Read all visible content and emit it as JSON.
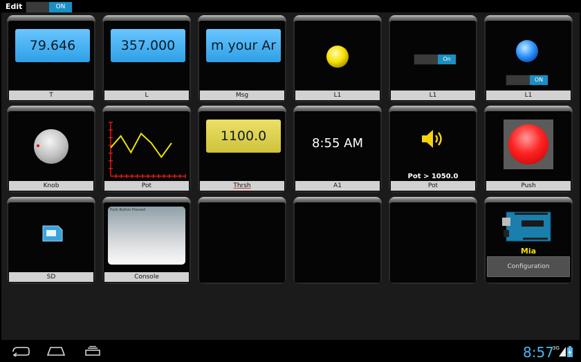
{
  "topbar": {
    "edit_label": "Edit",
    "edit_toggle_state": "ON"
  },
  "tiles": {
    "t_value": "79.646",
    "t_label": "T",
    "l_value": "357.000",
    "l_label": "L",
    "msg_value": "m your Ar",
    "msg_label": "Msg",
    "l1a_label": "L1",
    "l1b_label": "L1",
    "l1b_toggle": "On",
    "l1c_label": "L1",
    "l1c_toggle": "ON",
    "knob_label": "Knob",
    "pot_label": "Pot",
    "thrsh_value": "1100.0",
    "thrsh_label": "Thrsh",
    "a1_value": "8:55 AM",
    "a1_label": "A1",
    "sound_text": "Pot > 1050.0",
    "sound_label": "Pot",
    "push_label": "Push",
    "sd_label": "SD",
    "console_text": "Push Button Pressed",
    "console_label": "Console",
    "board_name": "Mia",
    "config_label": "Configuration"
  },
  "chart_data": {
    "type": "line",
    "title": "",
    "xlabel": "",
    "ylabel": "",
    "x": [
      1,
      2,
      3,
      4,
      5,
      6,
      7
    ],
    "values": [
      40,
      65,
      30,
      70,
      50,
      20,
      50
    ],
    "ylim": [
      0,
      100
    ]
  },
  "statusbar": {
    "time": "8:57",
    "network": "3G"
  },
  "colors": {
    "accent": "#1a8fc4",
    "lcd_blue": "#3aaaf0",
    "lcd_yellow": "#e0d24a",
    "clock_blue": "#4fb8ea"
  }
}
